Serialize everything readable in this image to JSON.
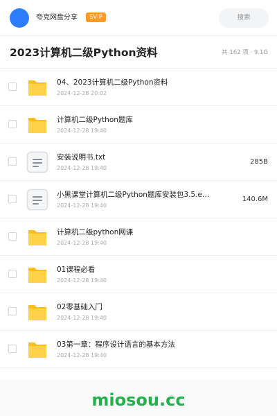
{
  "header": {
    "brand": "夸克网盘分享",
    "badge": "SVIP",
    "search_label": "搜索"
  },
  "page": {
    "title": "2023计算机二级Python资料",
    "meta": "共 162 项 · 9.1G"
  },
  "files": [
    {
      "type": "folder",
      "name": "04、2023计算机二级Python资料",
      "date": "2024-12-28 20:02",
      "size": ""
    },
    {
      "type": "folder",
      "name": "计算机二级Python题库",
      "date": "2024-12-28 19:40",
      "size": ""
    },
    {
      "type": "document",
      "name": "安装说明书.txt",
      "date": "2024-12-28 19:40",
      "size": "285B"
    },
    {
      "type": "document",
      "name": "小黑课堂计算机二级Python题库安装包3.5.e…",
      "date": "2024-12-28 19:40",
      "size": "140.6M"
    },
    {
      "type": "folder",
      "name": "计算机二级python网课",
      "date": "2024-12-28 19:40",
      "size": ""
    },
    {
      "type": "folder",
      "name": "01课程必看",
      "date": "2024-12-28 19:40",
      "size": ""
    },
    {
      "type": "folder",
      "name": "02零基础入门",
      "date": "2024-12-28 19:40",
      "size": ""
    },
    {
      "type": "folder",
      "name": "03第一章：程序设计语言的基本方法",
      "date": "2024-12-28 19:40",
      "size": ""
    }
  ],
  "watermark": "miosou.cc",
  "colors": {
    "avatar": "#2f7dff",
    "badge": "#ff9a27",
    "folder": "#ffc933",
    "watermark": "#22b14c"
  }
}
